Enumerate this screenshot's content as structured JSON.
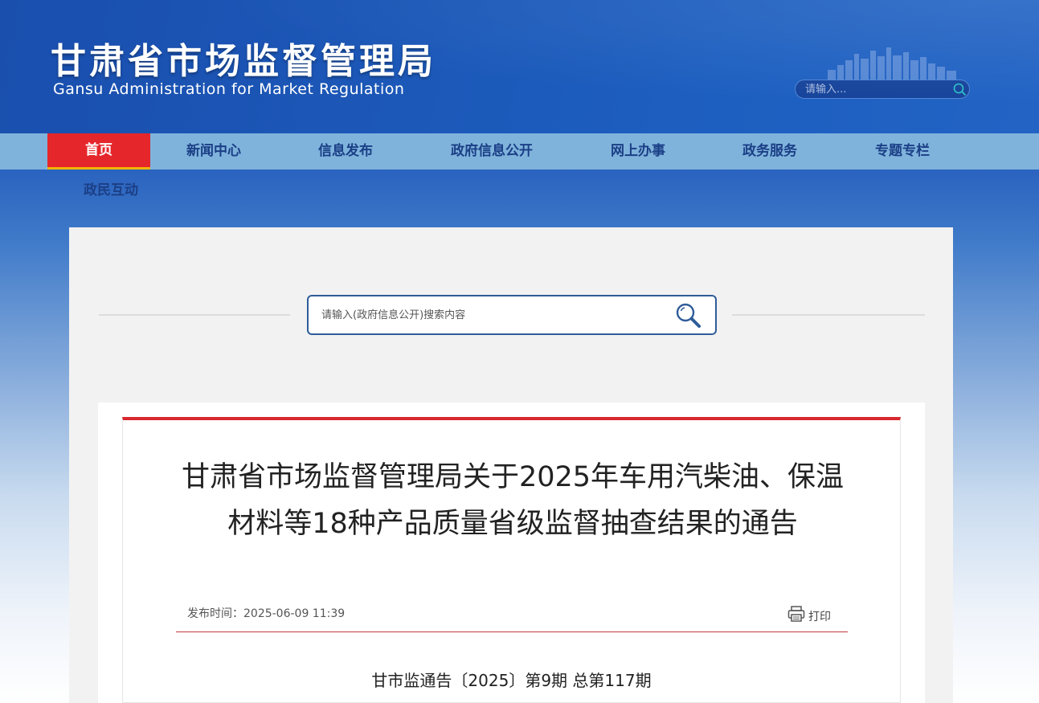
{
  "header": {
    "title_cn": "甘肃省市场监督管理局",
    "title_en": "Gansu Administration for Market Regulation",
    "search_placeholder": "请输入...",
    "search_icon": "search-icon"
  },
  "nav": {
    "items": [
      {
        "label": "首页",
        "active": true
      },
      {
        "label": "新闻中心"
      },
      {
        "label": "信息发布"
      },
      {
        "label": "政府信息公开"
      },
      {
        "label": "网上办事"
      },
      {
        "label": "政务服务"
      },
      {
        "label": "专题专栏"
      }
    ],
    "row2": "政民互动"
  },
  "main_search": {
    "placeholder": "请输入(政府信息公开)搜索内容",
    "icon": "magnifier-icon"
  },
  "article": {
    "title": "甘肃省市场监督管理局关于2025年车用汽柴油、保温材料等18种产品质量省级监督抽查结果的通告",
    "publish_label": "发布时间：",
    "publish_time": "2025-06-09 11:39",
    "print_label": "打印",
    "doc_number": "甘市监通告〔2025〕第9期   总第117期"
  },
  "colors": {
    "header_blue": "#1d58b8",
    "nav_bg": "#7fb3dc",
    "nav_text": "#1b3f86",
    "active_red": "#e5262b",
    "active_underline": "#f2b400",
    "accent_red": "#d8282e"
  }
}
